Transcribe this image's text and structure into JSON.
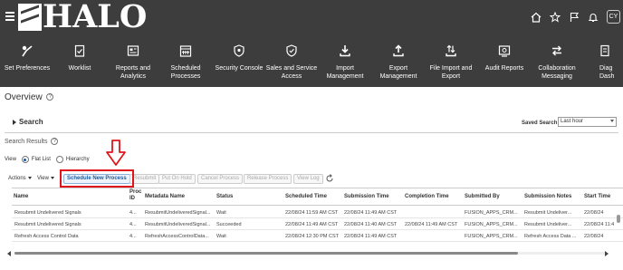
{
  "header": {
    "logo_text": "HALO",
    "avatar_initials": "CY",
    "icons": [
      "home-icon",
      "star-icon",
      "flag-icon",
      "bell-icon"
    ]
  },
  "nav": {
    "items": [
      {
        "label": "Set Preferences",
        "icon": "preferences-icon"
      },
      {
        "label": "Worklist",
        "icon": "worklist-icon"
      },
      {
        "label": "Reports and\nAnalytics",
        "icon": "reports-icon"
      },
      {
        "label": "Scheduled\nProcesses",
        "icon": "calendar-icon"
      },
      {
        "label": "Security Console",
        "icon": "security-icon"
      },
      {
        "label": "Sales and Service\nAccess",
        "icon": "shield-icon"
      },
      {
        "label": "Import\nManagement",
        "icon": "download-icon"
      },
      {
        "label": "Export\nManagement",
        "icon": "upload-icon"
      },
      {
        "label": "File Import and\nExport",
        "icon": "transfer-icon"
      },
      {
        "label": "Audit Reports",
        "icon": "audit-icon"
      },
      {
        "label": "Collaboration\nMessaging",
        "icon": "exchange-icon"
      },
      {
        "label": "Diag\nDash",
        "icon": "diagnostics-icon"
      }
    ]
  },
  "page": {
    "title": "Overview"
  },
  "search": {
    "label": "Search",
    "saved_search_label": "Saved Search",
    "saved_search_value": "Last hour"
  },
  "results": {
    "title": "Search Results",
    "view_label": "View",
    "view_options": [
      "Flat List",
      "Hierarchy"
    ],
    "selected_view": "Flat List"
  },
  "toolbar": {
    "actions": "Actions",
    "view": "View",
    "schedule_new": "Schedule New Process",
    "resubmit": "Resubmit",
    "put_on_hold": "Put On Hold",
    "cancel_process": "Cancel Process",
    "release_process": "Release Process",
    "view_log": "View Log"
  },
  "table": {
    "columns": [
      "Name",
      "Proc\nID",
      "Metadata Name",
      "Status",
      "Scheduled Time",
      "Submission Time",
      "Completion Time",
      "Submitted By",
      "Submission Notes",
      "Start Time"
    ],
    "rows": [
      [
        "Resubmit Undelivered Signals",
        "4...",
        "ResubmitUndeliveredSignal...",
        "Wait",
        "22/08/24 11:59 AM CST",
        "22/08/24 11:49 AM CST",
        "",
        "FUSION_APPS_CRM...",
        "Resubmit Undeliver...",
        "22/08/24"
      ],
      [
        "Resubmit Undelivered Signals",
        "4...",
        "ResubmitUndeliveredSignal...",
        "Succeeded",
        "22/08/24 11:49 AM CST",
        "22/08/24 11:40 AM CST",
        "22/08/24 11:49 AM CST",
        "FUSION_APPS_CRM...",
        "Resubmit Undeliver...",
        "22/08/24 11:4"
      ],
      [
        "Refresh Access Control Data",
        "4...",
        "RefreshAccessControlData...",
        "Wait",
        "22/08/24 12:30 PM CST",
        "22/08/24 11:49 AM CST",
        "",
        "FUSION_APPS_CRM...",
        "Refresh Access Data ...",
        "22/08/24"
      ]
    ]
  },
  "colors": {
    "topbar": "#3d3d3d",
    "highlight": "#e0151b",
    "link": "#1a5a9e"
  }
}
